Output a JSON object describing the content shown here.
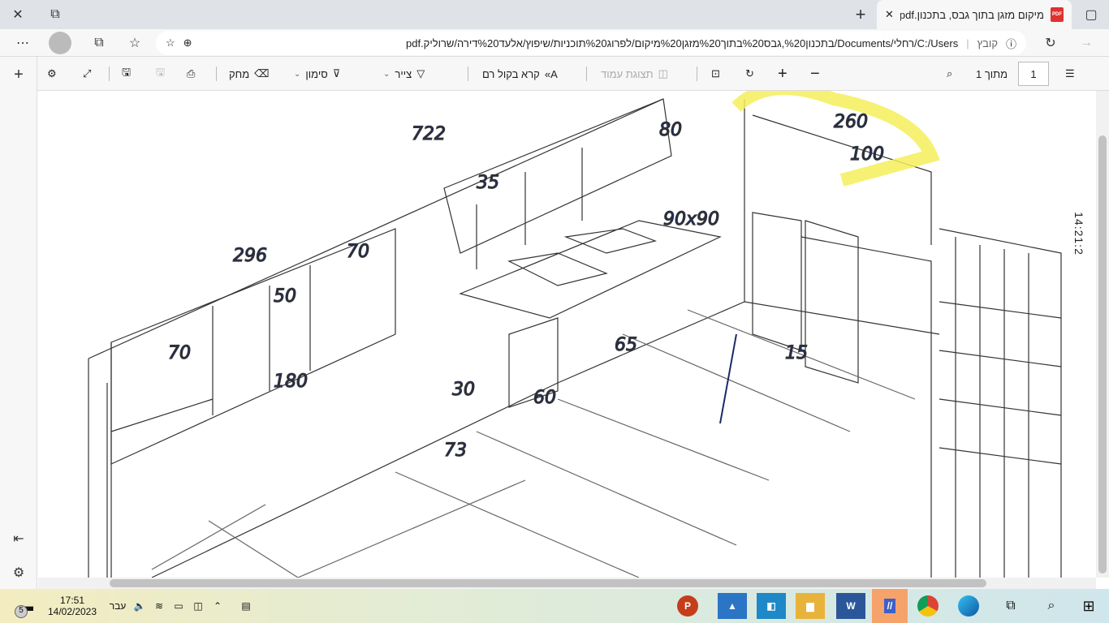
{
  "browser": {
    "tab": {
      "title": "מיקום מזגן בתוך גבס, בתכנון.pdf",
      "icon": "pdf-icon"
    },
    "address": {
      "label": "קובץ",
      "url": "C:/Users/רחלי/Documents/בתכנון%20,גבס%20בתוך%20מזגן%20מיקום/לפרוג%20תוכניות/שיפוץ/אלעד%20דירה/שרוליק.pdf"
    }
  },
  "pdf_toolbar": {
    "page_current": "1",
    "page_total": "מתוך 1",
    "page_view": "תצוגת עמוד",
    "read_aloud": "קרא בקול רם",
    "draw": "צייר",
    "highlight": "סימון",
    "erase": "מחק"
  },
  "drawing": {
    "labels": [
      "722",
      "296",
      "70",
      "50",
      "35",
      "70",
      "80",
      "90x90",
      "60",
      "180",
      "100",
      "260",
      "30",
      "15",
      "73",
      "65"
    ]
  },
  "side_clock": "14:21:2",
  "taskbar": {
    "time": "17:51",
    "date": "14/02/2023",
    "language": "עבר",
    "notifications": "5",
    "apps": [
      "PowerPoint",
      "Photos",
      "Remote Desktop",
      "File Explorer",
      "Word",
      "Autodesk",
      "Chrome",
      "Edge"
    ]
  }
}
